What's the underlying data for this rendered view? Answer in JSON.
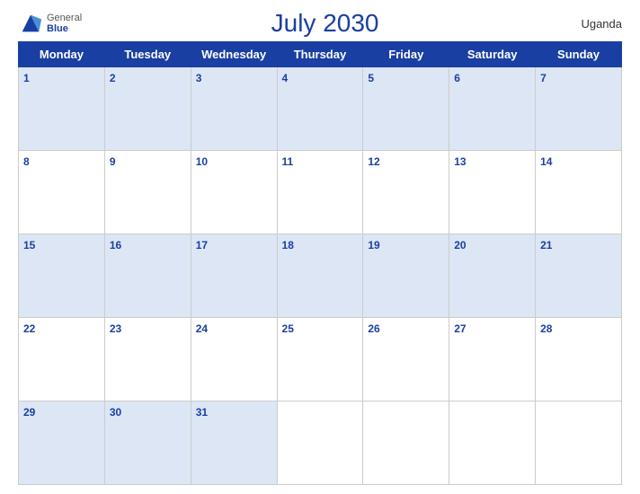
{
  "header": {
    "title": "July 2030",
    "country": "Uganda",
    "logo": {
      "general": "General",
      "blue": "Blue"
    }
  },
  "weekdays": [
    "Monday",
    "Tuesday",
    "Wednesday",
    "Thursday",
    "Friday",
    "Saturday",
    "Sunday"
  ],
  "weeks": [
    [
      1,
      2,
      3,
      4,
      5,
      6,
      7
    ],
    [
      8,
      9,
      10,
      11,
      12,
      13,
      14
    ],
    [
      15,
      16,
      17,
      18,
      19,
      20,
      21
    ],
    [
      22,
      23,
      24,
      25,
      26,
      27,
      28
    ],
    [
      29,
      30,
      31,
      null,
      null,
      null,
      null
    ]
  ]
}
